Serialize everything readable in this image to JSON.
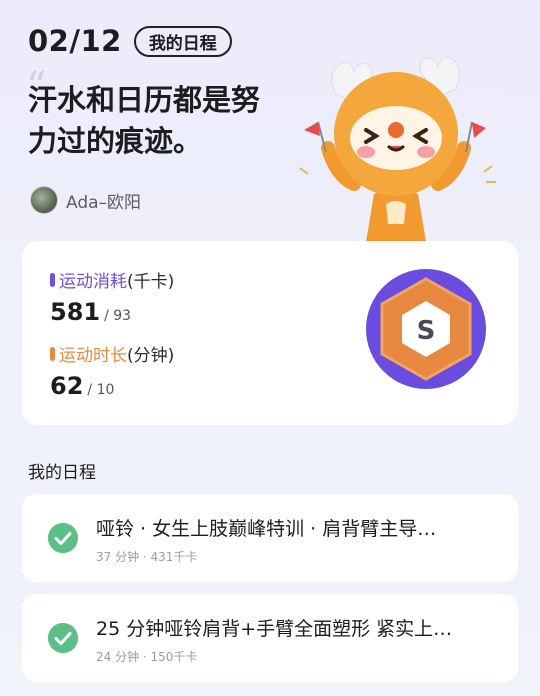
{
  "header": {
    "date": "02/12",
    "schedule_chip": "我的日程"
  },
  "quote": {
    "mark": "“",
    "line1": "汗水和日历都是努",
    "line2": "力过的痕迹。"
  },
  "author": {
    "name": "Ada–欧阳"
  },
  "stats": {
    "calories": {
      "label": "运动消耗",
      "unit": "(千卡)",
      "value": "581",
      "target": "/ 93",
      "accent": "#6f4ee0"
    },
    "duration": {
      "label": "运动时长",
      "unit": "(分钟)",
      "value": "62",
      "target": "/ 10",
      "accent": "#ed8a38"
    },
    "badge": {
      "letter": "S",
      "outer_color": "#6a4de0",
      "ring_color": "#e7883f",
      "inner_color": "#ffffff"
    }
  },
  "schedule": {
    "section_title": "我的日程",
    "items": [
      {
        "title": "哑铃 · 女生上肢巅峰特训 · 肩背臂主导…",
        "meta": "37 分钟 · 431千卡",
        "done_icon": "check-circle-icon"
      },
      {
        "title": "25 分钟哑铃肩背+手臂全面塑形 紧实上…",
        "meta": "24 分钟 · 150千卡",
        "done_icon": "check-circle-icon"
      }
    ]
  },
  "colors": {
    "check_green": "#5cc086",
    "background": "#eeeffb"
  }
}
